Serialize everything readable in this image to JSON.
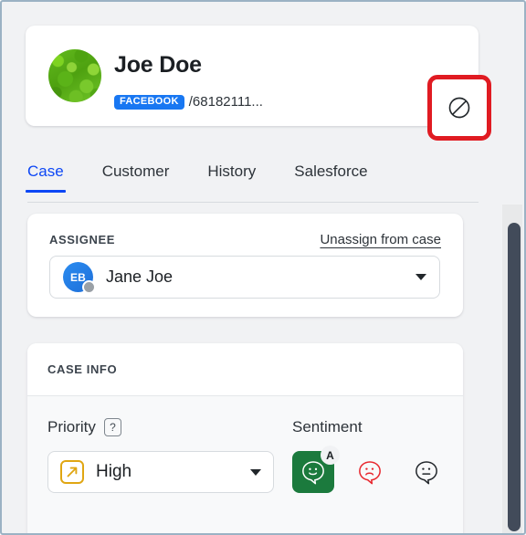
{
  "header": {
    "person_name": "Joe Doe",
    "channel_badge": "FACEBOOK",
    "channel_handle": "/68182111...",
    "block_icon": "ban-circle-slash-icon",
    "avatar_alt": "green-foliage-avatar",
    "annotation_color": "#e01b22"
  },
  "tabs": [
    {
      "label": "Case",
      "active": true
    },
    {
      "label": "Customer",
      "active": false
    },
    {
      "label": "History",
      "active": false
    },
    {
      "label": "Salesforce",
      "active": false
    }
  ],
  "assignee": {
    "section_label": "ASSIGNEE",
    "unassign_label": "Unassign from case",
    "agent_initials": "EB",
    "agent_name": "Jane Joe",
    "presence_color": "#9aa0a6",
    "avatar_color": "#1e6fd9"
  },
  "case_info": {
    "section_label": "CASE INFO",
    "priority": {
      "label": "Priority",
      "help_glyph": "?",
      "value": "High",
      "icon": "arrow-up-right-icon",
      "icon_color": "#e0a612"
    },
    "sentiment": {
      "label": "Sentiment",
      "options": [
        {
          "name": "positive",
          "glyph": "happy-face-bubble-icon",
          "selected": true,
          "auto_badge": "A",
          "color": "#ffffff",
          "bg": "#1b7a3d"
        },
        {
          "name": "negative",
          "glyph": "sad-face-bubble-icon",
          "selected": false,
          "auto_badge": "",
          "color": "#e8262d",
          "bg": "transparent"
        },
        {
          "name": "neutral",
          "glyph": "neutral-face-bubble-icon",
          "selected": false,
          "auto_badge": "",
          "color": "#22272b",
          "bg": "transparent"
        }
      ]
    }
  },
  "theme": {
    "page_bg": "#f1f2f4",
    "accent_blue": "#0d47f5",
    "facebook_blue": "#1877f2",
    "scrollbar_thumb": "#424b5a"
  }
}
